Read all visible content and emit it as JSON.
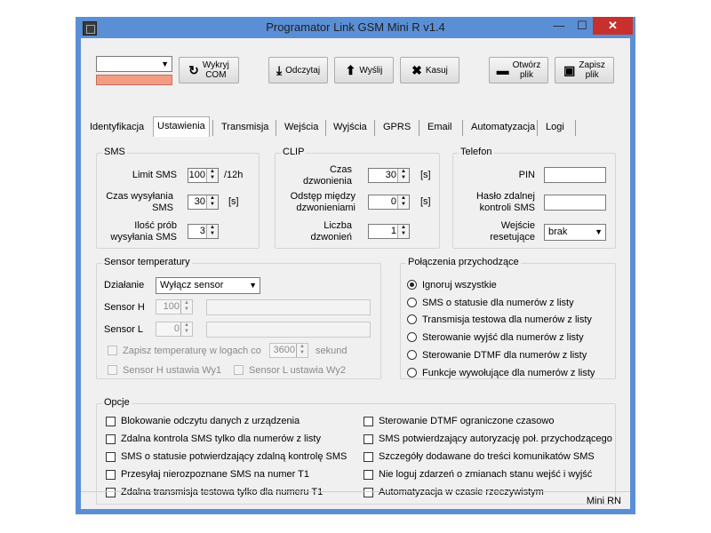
{
  "window": {
    "title": "Programator Link GSM Mini R v1.4",
    "min": "—",
    "max": "☐",
    "close": "✕"
  },
  "toolbar": {
    "detect": "Wykryj\nCOM",
    "read": "Odczytaj",
    "send": "Wyślij",
    "delete": "Kasuj",
    "open": "Otwórz\nplik",
    "save": "Zapisz\nplik",
    "com_value": ""
  },
  "tabs": [
    "Identyfikacja",
    "Ustawienia",
    "Transmisja",
    "Wejścia",
    "Wyjścia",
    "GPRS",
    "Email",
    "Automatyzacja",
    "Logi"
  ],
  "sms": {
    "title": "SMS",
    "limit_label": "Limit SMS",
    "limit_value": "100",
    "limit_unit": "/12h",
    "time_label": "Czas wysyłania SMS",
    "time_value": "30",
    "time_unit": "[s]",
    "tries_label": "Ilość prób wysyłania SMS",
    "tries_value": "3"
  },
  "clip": {
    "title": "CLIP",
    "ring_label": "Czas dzwonienia",
    "ring_value": "30",
    "ring_unit": "[s]",
    "gap_label": "Odstęp między dzwonieniami",
    "gap_value": "0",
    "gap_unit": "[s]",
    "count_label": "Liczba dzwonień",
    "count_value": "1"
  },
  "phone": {
    "title": "Telefon",
    "pin_label": "PIN",
    "remote_label": "Hasło zdalnej kontroli SMS",
    "reset_label": "Wejście resetujące",
    "reset_value": "brak"
  },
  "sensor": {
    "title": "Sensor temperatury",
    "action_label": "Działanie",
    "action_value": "Wyłącz sensor",
    "h_label": "Sensor H",
    "h_value": "100",
    "l_label": "Sensor L",
    "l_value": "0",
    "log_label": "Zapisz temperaturę w logach co",
    "log_value": "3600",
    "log_unit": "sekund",
    "h_wy1": "Sensor H ustawia Wy1",
    "l_wy2": "Sensor L ustawia Wy2"
  },
  "incoming": {
    "title": "Połączenia przychodzące",
    "options": [
      "Ignoruj wszystkie",
      "SMS o statusie dla numerów z listy",
      "Transmisja testowa dla numerów z listy",
      "Sterowanie wyjść dla numerów z listy",
      "Sterowanie DTMF dla numerów z listy",
      "Funkcje wywołujące dla numerów z listy"
    ],
    "selected": 0
  },
  "options": {
    "title": "Opcje",
    "left": [
      "Blokowanie odczytu danych z urządzenia",
      "Zdalna kontrola SMS tylko dla numerów z listy",
      "SMS o statusie potwierdzający zdalną kontrolę SMS",
      "Przesyłaj nierozpoznane SMS na numer T1",
      "Zdalna transmisja testowa tylko dla numeru T1"
    ],
    "right": [
      "Sterowanie DTMF ograniczone czasowo",
      "SMS potwierdzający autoryzację poł. przychodzącego",
      "Szczegóły dodawane do treści komunikatów SMS",
      "Nie loguj zdarzeń o zmianach stanu wejść i wyjść",
      "Automatyzacja w czasie rzeczywistym"
    ]
  },
  "status": {
    "device": "Mini RN"
  },
  "colors": {
    "titlebar": "#5a8fd6",
    "close": "#c7302c",
    "com_indicator": "#f39c83"
  }
}
